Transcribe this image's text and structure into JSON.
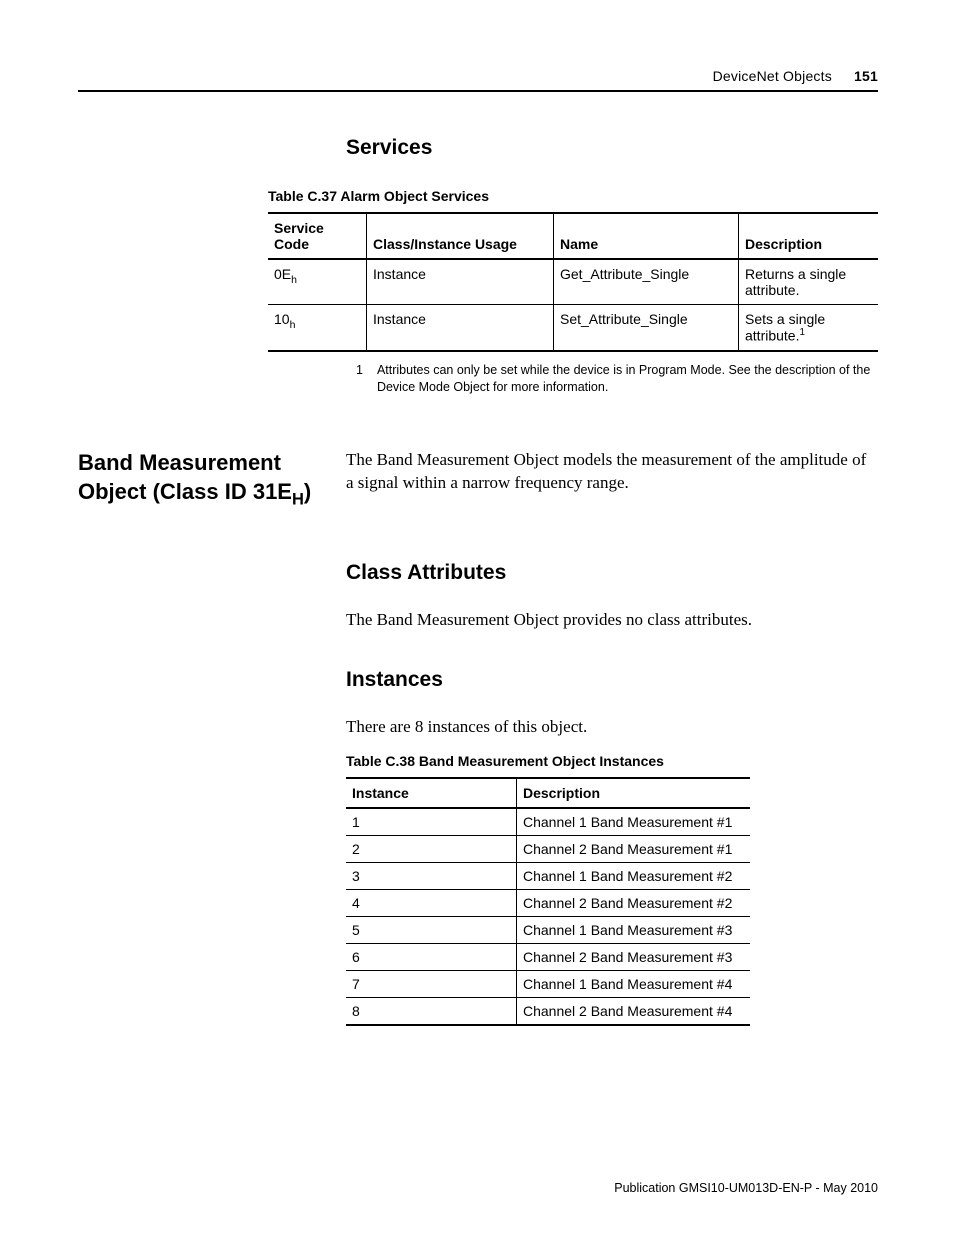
{
  "header": {
    "section": "DeviceNet Objects",
    "page": "151"
  },
  "services": {
    "heading": "Services",
    "caption": "Table C.37 Alarm Object Services",
    "cols": [
      "Service Code",
      "Class/Instance Usage",
      "Name",
      "Description"
    ],
    "rows": [
      {
        "code": "0E",
        "codeSub": "h",
        "usage": "Instance",
        "name": "Get_Attribute_Single",
        "desc": "Returns a single attribute."
      },
      {
        "code": "10",
        "codeSub": "h",
        "usage": "Instance",
        "name": "Set_Attribute_Single",
        "desc": "Sets a single attribute.",
        "sup": "1"
      }
    ],
    "footnote": {
      "num": "1",
      "text": "Attributes can only be set while the device is in Program Mode. See the description of the Device Mode Object for more information."
    }
  },
  "band": {
    "side_title_pre": "Band Measurement Object (Class ID 31E",
    "side_title_sub": "H",
    "side_title_post": ")",
    "intro": "The Band Measurement Object models the measurement of the amplitude of a signal within a narrow frequency range.",
    "class_attr_heading": "Class Attributes",
    "class_attr_text": "The Band Measurement Object provides no class attributes.",
    "instances_heading": "Instances",
    "instances_text": "There are 8 instances of this object.",
    "instances_caption": "Table C.38 Band Measurement Object Instances",
    "instances_cols": [
      "Instance",
      "Description"
    ],
    "instances_rows": [
      {
        "n": "1",
        "d": "Channel 1 Band Measurement #1"
      },
      {
        "n": "2",
        "d": "Channel 2 Band Measurement #1"
      },
      {
        "n": "3",
        "d": "Channel 1 Band Measurement #2"
      },
      {
        "n": "4",
        "d": "Channel 2 Band Measurement #2"
      },
      {
        "n": "5",
        "d": "Channel 1 Band Measurement #3"
      },
      {
        "n": "6",
        "d": "Channel 2 Band Measurement #3"
      },
      {
        "n": "7",
        "d": "Channel 1 Band Measurement #4"
      },
      {
        "n": "8",
        "d": "Channel 2 Band Measurement #4"
      }
    ]
  },
  "footer": "Publication GMSI10-UM013D-EN-P - May 2010"
}
